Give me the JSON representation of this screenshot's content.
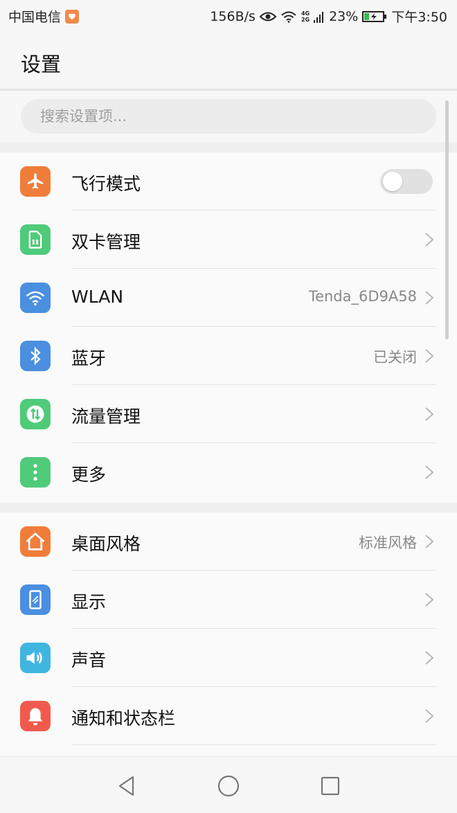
{
  "status_bar": {
    "carrier": "中国电信",
    "net_speed": "156B/s",
    "network_type_top": "4G",
    "network_type_bottom": "2G",
    "battery_percent": "23%",
    "time": "下午3:50"
  },
  "title": "设置",
  "search": {
    "placeholder": "搜索设置项..."
  },
  "group1": [
    {
      "label": "飞行模式",
      "icon": "airplane-icon",
      "color": "#f07d3a",
      "toggle": false
    },
    {
      "label": "双卡管理",
      "icon": "sim-card-icon",
      "color": "#4fcb7a"
    },
    {
      "label": "WLAN",
      "icon": "wifi-icon",
      "color": "#4a8fe0",
      "value": "Tenda_6D9A58"
    },
    {
      "label": "蓝牙",
      "icon": "bluetooth-icon",
      "color": "#4a8fe0",
      "value": "已关闭"
    },
    {
      "label": "流量管理",
      "icon": "data-usage-icon",
      "color": "#4fcb7a"
    },
    {
      "label": "更多",
      "icon": "more-vertical-icon",
      "color": "#4fcb7a"
    }
  ],
  "group2": [
    {
      "label": "桌面风格",
      "icon": "home-icon",
      "color": "#f07d3a",
      "value": "标准风格"
    },
    {
      "label": "显示",
      "icon": "display-icon",
      "color": "#4a8fe0"
    },
    {
      "label": "声音",
      "icon": "speaker-icon",
      "color": "#3fb6e0"
    },
    {
      "label": "通知和状态栏",
      "icon": "bell-icon",
      "color": "#f05a4d"
    }
  ]
}
